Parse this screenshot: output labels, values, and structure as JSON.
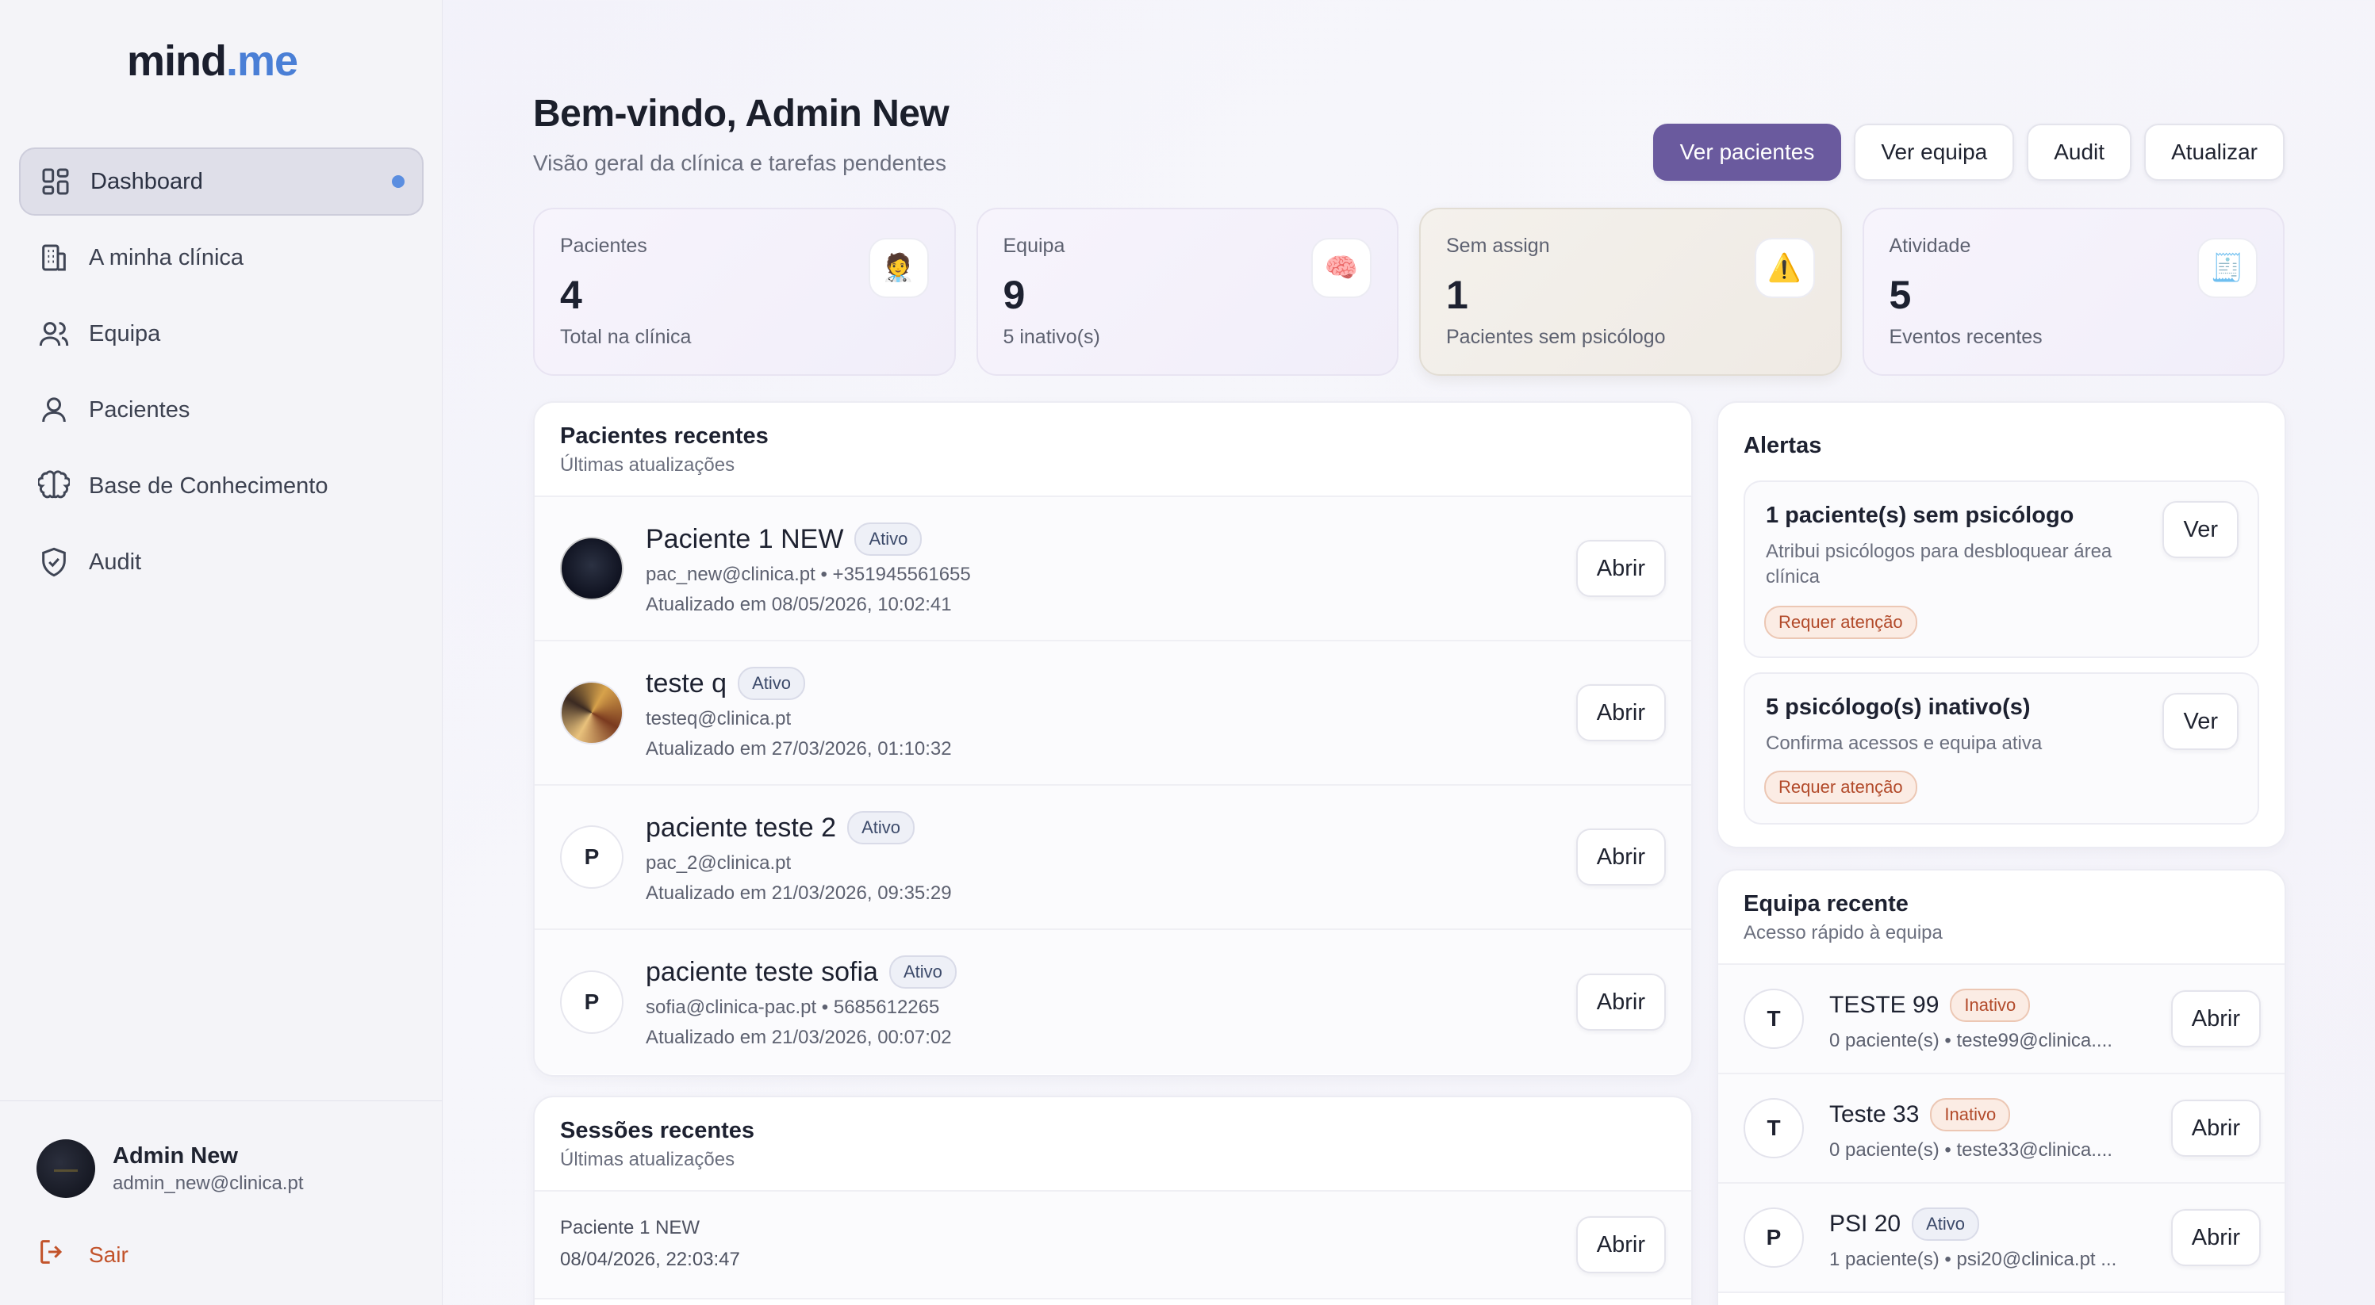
{
  "brand": {
    "name_main": "mind",
    "name_accent": ".me"
  },
  "sidebar": {
    "items": [
      {
        "label": "Dashboard",
        "icon": "dashboard-icon"
      },
      {
        "label": "A minha clínica",
        "icon": "building-icon"
      },
      {
        "label": "Equipa",
        "icon": "users-icon"
      },
      {
        "label": "Pacientes",
        "icon": "user-icon"
      },
      {
        "label": "Base de Conhecimento",
        "icon": "brain-icon"
      },
      {
        "label": "Audit",
        "icon": "shield-check-icon"
      }
    ],
    "user": {
      "name": "Admin New",
      "email": "admin_new@clinica.pt"
    },
    "logout_label": "Sair"
  },
  "header": {
    "title": "Bem-vindo, Admin New",
    "subtitle": "Visão geral da clínica e tarefas pendentes",
    "actions": {
      "patients": "Ver pacientes",
      "team": "Ver equipa",
      "audit": "Audit",
      "refresh": "Atualizar"
    }
  },
  "stats": [
    {
      "label": "Pacientes",
      "value": "4",
      "note": "Total na clínica",
      "icon": "🧑‍⚕️"
    },
    {
      "label": "Equipa",
      "value": "9",
      "note": "5 inativo(s)",
      "icon": "🧠"
    },
    {
      "label": "Sem assign",
      "value": "1",
      "note": "Pacientes sem psicólogo",
      "icon": "⚠️"
    },
    {
      "label": "Atividade",
      "value": "5",
      "note": "Eventos recentes",
      "icon": "🧾"
    }
  ],
  "recent_patients": {
    "title": "Pacientes recentes",
    "subtitle": "Últimas atualizações",
    "open_label": "Abrir",
    "rows": [
      {
        "name": "Paciente 1 NEW",
        "status": "Ativo",
        "contact": "pac_new@clinica.pt • +351945561655",
        "updated": "Atualizado em 08/05/2026, 10:02:41",
        "initial": ""
      },
      {
        "name": "teste q",
        "status": "Ativo",
        "contact": "testeq@clinica.pt",
        "updated": "Atualizado em 27/03/2026, 01:10:32",
        "initial": ""
      },
      {
        "name": "paciente teste 2",
        "status": "Ativo",
        "contact": "pac_2@clinica.pt",
        "updated": "Atualizado em 21/03/2026, 09:35:29",
        "initial": "P"
      },
      {
        "name": "paciente teste sofia",
        "status": "Ativo",
        "contact": "sofia@clinica-pac.pt • 5685612265",
        "updated": "Atualizado em 21/03/2026, 00:07:02",
        "initial": "P"
      }
    ]
  },
  "recent_sessions": {
    "title": "Sessões recentes",
    "subtitle": "Últimas atualizações",
    "open_label": "Abrir",
    "rows": [
      {
        "patient": "Paciente 1 NEW",
        "date": "08/04/2026, 22:03:47"
      }
    ]
  },
  "alerts": {
    "title": "Alertas",
    "items": [
      {
        "title": "1 paciente(s) sem psicólogo",
        "desc": "Atribui psicólogos para desbloquear área clínica",
        "tag": "Requer atenção",
        "action": "Ver"
      },
      {
        "title": "5 psicólogo(s) inativo(s)",
        "desc": "Confirma acessos e equipa ativa",
        "tag": "Requer atenção",
        "action": "Ver"
      }
    ]
  },
  "recent_team": {
    "title": "Equipa recente",
    "subtitle": "Acesso rápido à equipa",
    "open_label": "Abrir",
    "rows": [
      {
        "initial": "T",
        "name": "TESTE 99",
        "status": "Inativo",
        "meta": "0 paciente(s) • teste99@clinica...."
      },
      {
        "initial": "T",
        "name": "Teste 33",
        "status": "Inativo",
        "meta": "0 paciente(s) • teste33@clinica...."
      },
      {
        "initial": "P",
        "name": "PSI 20",
        "status": "Ativo",
        "meta": "1 paciente(s) • psi20@clinica.pt ..."
      }
    ]
  },
  "colors": {
    "accent": "#6a5a9e",
    "link": "#4a7fd6",
    "warning": "#b24a2a",
    "logout": "#c2532b"
  }
}
